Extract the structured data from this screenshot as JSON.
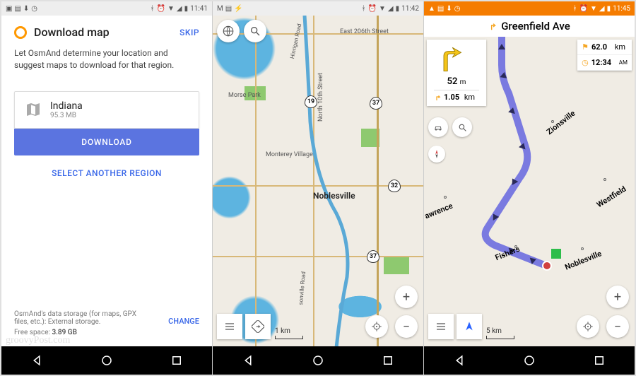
{
  "status": {
    "time1": "11:41",
    "time2": "11:42",
    "time3": "11:45"
  },
  "screen1": {
    "title": "Download map",
    "skip": "SKIP",
    "desc": "Let OsmAnd determine your location and suggest maps to download for that region.",
    "map_name": "Indiana",
    "map_size": "95.3 MB",
    "download": "DOWNLOAD",
    "select_region": "SELECT ANOTHER REGION",
    "storage_note": "OsmAnd's data storage (for maps, GPX files, etc.): External storage.",
    "free_space_label": "Free space:",
    "free_space": "3.89 GB",
    "change": "CHANGE"
  },
  "screen2": {
    "labels": {
      "east206": "East 206th Street",
      "morse": "Morse Park",
      "monterey": "Monterey Village",
      "noblesville": "Noblesville",
      "north10": "North 10th Street",
      "hinrigan": "Hinrigan Road",
      "sonville": "sonville Road"
    },
    "shields": {
      "r19": "19",
      "r37a": "37",
      "r32": "32",
      "r37b": "37"
    },
    "scale": "1 km"
  },
  "screen3": {
    "street": "Greenfield Ave",
    "turn_dist_val": "52",
    "turn_dist_unit": "m",
    "next_turn_val": "1.05",
    "next_turn_unit": "km",
    "total_dist_val": "62.0",
    "total_dist_unit": "km",
    "eta": "12:34",
    "eta_unit": "AM",
    "labels": {
      "zionsville": "Zionsville",
      "westfield": "Westfield",
      "awrence": "awrence",
      "fishers": "Fishers",
      "noblesville": "Noblesville"
    },
    "scale": "5 km"
  },
  "watermark": "groovyPost.com"
}
